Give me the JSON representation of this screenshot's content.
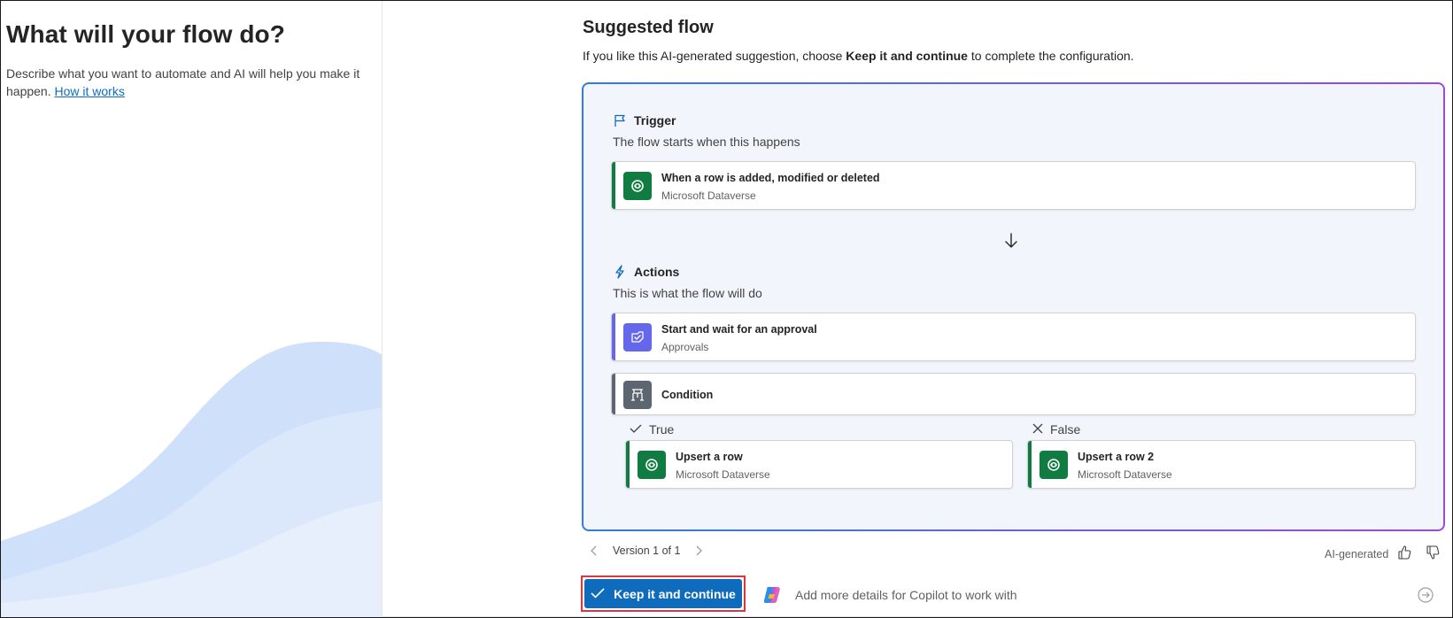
{
  "left": {
    "heading": "What will your flow do?",
    "description": "Describe what you want to automate and AI will help you make it happen.",
    "link_label": "How it works"
  },
  "suggested": {
    "title": "Suggested flow",
    "intro_before": "If you like this AI-generated suggestion, choose ",
    "intro_bold": "Keep it and continue",
    "intro_after": " to complete the configuration."
  },
  "trigger": {
    "heading": "Trigger",
    "subtitle": "The flow starts when this happens",
    "card": {
      "name": "When a row is added, modified or deleted",
      "connector": "Microsoft Dataverse",
      "color": "#107c41"
    }
  },
  "actions": {
    "heading": "Actions",
    "subtitle": "This is what the flow will do",
    "items": [
      {
        "name": "Start and wait for an approval",
        "connector": "Approvals",
        "color": "#6466ec"
      },
      {
        "name": "Condition",
        "connector": "",
        "color": "#5c6570"
      }
    ]
  },
  "branches": {
    "true_label": "True",
    "false_label": "False",
    "true_card": {
      "name": "Upsert a row",
      "connector": "Microsoft Dataverse",
      "color": "#107c41"
    },
    "false_card": {
      "name": "Upsert a row 2",
      "connector": "Microsoft Dataverse",
      "color": "#107c41"
    }
  },
  "footer": {
    "version": "Version 1 of 1",
    "ai_label": "AI-generated",
    "keep_button": "Keep it and continue",
    "copilot_placeholder": "Add more details for Copilot to work with"
  },
  "colors": {
    "accent": "#0f6cbd",
    "dataverse": "#107c41",
    "approvals": "#6466ec",
    "condition": "#5c6570",
    "highlight": "#e0343a"
  },
  "icons": [
    "flag-icon",
    "lightning-icon",
    "dataverse-icon",
    "approval-icon",
    "condition-icon",
    "checkmark-icon",
    "dismiss-icon",
    "arrow-down-icon",
    "chevron-left-icon",
    "chevron-right-icon",
    "thumbs-up-icon",
    "thumbs-down-icon",
    "copilot-icon",
    "send-icon"
  ]
}
